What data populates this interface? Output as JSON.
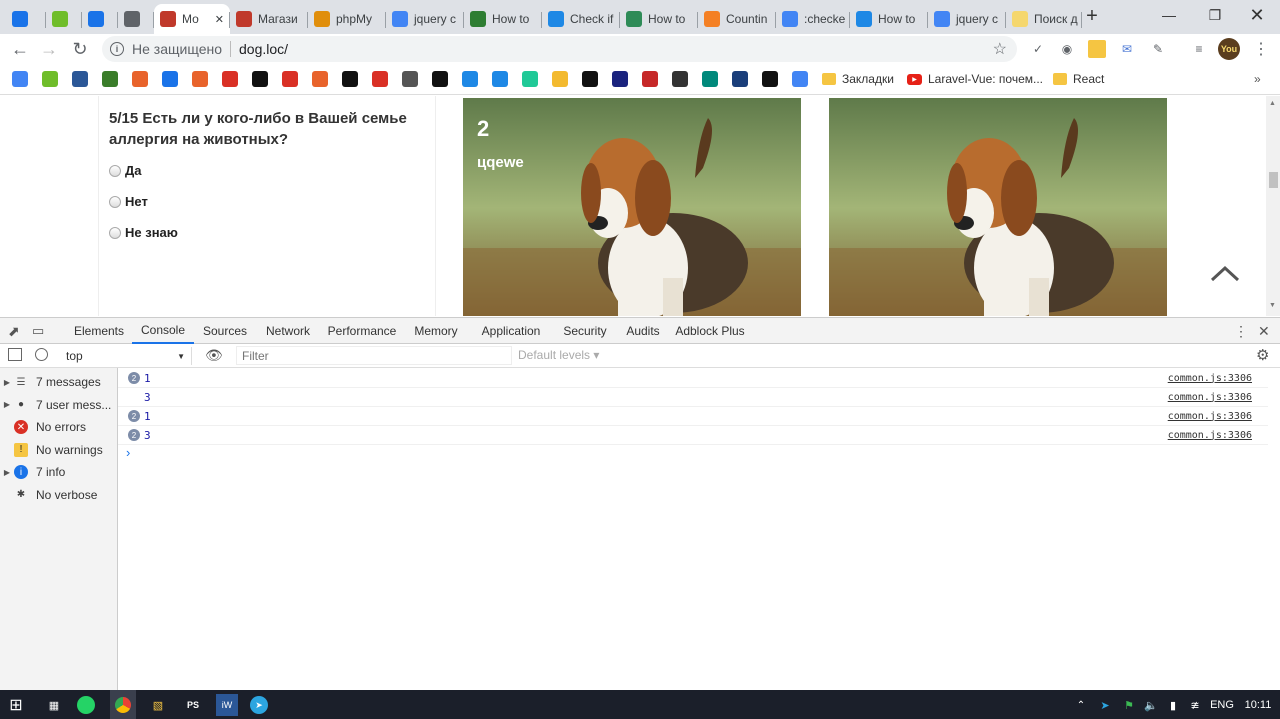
{
  "tabs": [
    {
      "icon": "mail-icon",
      "color": "#1a73e8",
      "label": ""
    },
    {
      "icon": "fl-icon",
      "color": "#6fbd2a",
      "label": ""
    },
    {
      "icon": "chat-icon",
      "color": "#1a73e8",
      "label": ""
    },
    {
      "icon": "speaker-icon",
      "color": "#5f6368",
      "label": ""
    },
    {
      "icon": "eye-icon",
      "color": "#c0392b",
      "label": "Мо"
    },
    {
      "icon": "eye-icon",
      "color": "#c0392b",
      "label": "Магази"
    },
    {
      "icon": "phpmyadmin-icon",
      "color": "#e08e0b",
      "label": "phpMy"
    },
    {
      "icon": "google-icon",
      "color": "#4285f4",
      "label": "jquery c"
    },
    {
      "icon": "cw-icon",
      "color": "#2e7d32",
      "label": "How to"
    },
    {
      "icon": "check-icon",
      "color": "#1e88e5",
      "label": "Check if"
    },
    {
      "icon": "gg-icon",
      "color": "#2e8b57",
      "label": "How to"
    },
    {
      "icon": "stackoverflow-icon",
      "color": "#f48024",
      "label": "Countin"
    },
    {
      "icon": "google-icon",
      "color": "#4285f4",
      "label": ":checke"
    },
    {
      "icon": "m-icon",
      "color": "#1e88e5",
      "label": "How to"
    },
    {
      "icon": "google-icon",
      "color": "#4285f4",
      "label": "jquery c"
    },
    {
      "icon": "jq-icon",
      "color": "#f5d76e",
      "label": "Поиск д"
    }
  ],
  "toolbar": {
    "security_text": "Не защищено",
    "url": "dog.loc/"
  },
  "bookmarks": {
    "folder1": "Закладки",
    "youtube": "Laravel-Vue: почем...",
    "folder2": "React"
  },
  "quiz": {
    "question": "5/15 Есть ли у кого-либо в Вашей семье аллергия на животных?",
    "options": [
      "Да",
      "Нет",
      "Не знаю"
    ]
  },
  "cards": [
    {
      "number": "2",
      "name": "цqewe"
    }
  ],
  "devtools": {
    "tabs": [
      "Elements",
      "Console",
      "Sources",
      "Network",
      "Performance",
      "Memory",
      "Application",
      "Security",
      "Audits",
      "Adblock Plus"
    ],
    "context": "top",
    "filter_placeholder": "Filter",
    "levels": "Default levels ▾",
    "sidebar": [
      {
        "label": "7 messages",
        "arrow": true,
        "icon": "list-icon"
      },
      {
        "label": "7 user mess...",
        "arrow": true,
        "icon": "user-icon"
      },
      {
        "label": "No errors",
        "arrow": false,
        "icon": "error-icon"
      },
      {
        "label": "No warnings",
        "arrow": false,
        "icon": "warning-icon"
      },
      {
        "label": "7 info",
        "arrow": true,
        "icon": "info-icon"
      },
      {
        "label": "No verbose",
        "arrow": false,
        "icon": "bug-icon"
      }
    ],
    "console_rows": [
      {
        "badge": "2",
        "text": "1",
        "src": "common.js:3306"
      },
      {
        "badge": "",
        "text": "3",
        "src": "common.js:3306"
      },
      {
        "badge": "2",
        "text": "1",
        "src": "common.js:3306"
      },
      {
        "badge": "2",
        "text": "3",
        "src": "common.js:3306"
      }
    ],
    "prompt": "›"
  },
  "taskbar": {
    "lang": "ENG",
    "time": "10:11"
  }
}
